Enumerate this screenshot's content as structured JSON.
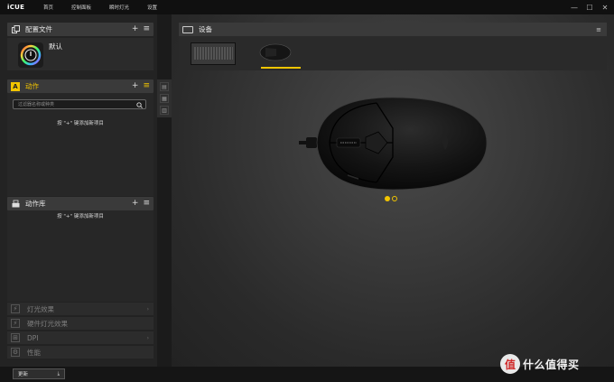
{
  "app": {
    "logo": "iCUE",
    "nav": [
      "首页",
      "控制面板",
      "瞬时灯光",
      "设置"
    ],
    "window_controls": [
      "—",
      "☐",
      "✕"
    ]
  },
  "profiles": {
    "title": "配置文件",
    "add": "+",
    "menu": "≡",
    "selected_profile": "默认"
  },
  "actions": {
    "badge": "A",
    "title": "动作",
    "add": "+",
    "menu": "≡",
    "search_placeholder": "过滤器名称或种类",
    "hint": "按 \"+\" 键添加新项目"
  },
  "action_library": {
    "title": "动作库",
    "add": "+",
    "menu": "≡",
    "hint": "按 \"+\" 键添加新项目"
  },
  "collapsed_sections": [
    {
      "label": "灯光效果",
      "chevron": "›",
      "icon": "lightning-icon"
    },
    {
      "label": "硬件灯光效果",
      "chevron": "",
      "icon": "lightning-icon"
    },
    {
      "label": "DPI",
      "chevron": "›",
      "icon": "dpi-icon"
    },
    {
      "label": "性能",
      "chevron": "",
      "icon": "performance-icon"
    }
  ],
  "devices": {
    "title": "设备",
    "menu": "≡",
    "items": [
      "keyboard",
      "mouse"
    ],
    "selected": "mouse",
    "carousel_pages": 2,
    "carousel_active": 1
  },
  "bottom": {
    "update_label": "更新",
    "update_icon": "⤓"
  },
  "watermark": {
    "badge": "值",
    "text": "什么值得买"
  },
  "colors": {
    "accent": "#f2c500",
    "panel": "#3a3a3a",
    "background": "#1b1b1b"
  }
}
